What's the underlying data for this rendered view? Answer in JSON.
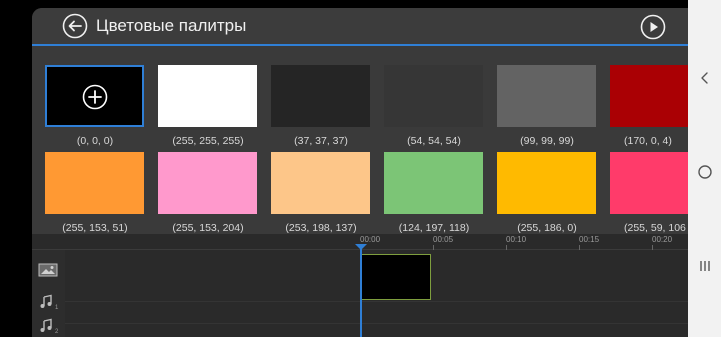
{
  "header": {
    "title": "Цветовые палитры",
    "back_icon": "back-arrow-circle-icon",
    "play_icon": "play-circle-icon"
  },
  "palettes": [
    {
      "label": "(0, 0, 0)",
      "color": "#000000",
      "selected": true,
      "add": true
    },
    {
      "label": "(255, 255, 255)",
      "color": "#ffffff"
    },
    {
      "label": "(37, 37, 37)",
      "color": "#252525"
    },
    {
      "label": "(54, 54, 54)",
      "color": "#363636"
    },
    {
      "label": "(99, 99, 99)",
      "color": "#636363"
    },
    {
      "label": "(170, 0, 4)",
      "color": "#aa0004"
    },
    {
      "label": "(255, 153, 51)",
      "color": "#ff9933"
    },
    {
      "label": "(255, 153, 204)",
      "color": "#ff99cc"
    },
    {
      "label": "(253, 198, 137)",
      "color": "#fdc689"
    },
    {
      "label": "(124, 197, 118)",
      "color": "#7cc576"
    },
    {
      "label": "(255, 186, 0)",
      "color": "#ffba00"
    },
    {
      "label": "(255, 59, 106",
      "color": "#ff3b6a"
    }
  ],
  "timeline": {
    "ticks": [
      "00:00",
      "00:05",
      "00:10",
      "00:15",
      "00:20"
    ],
    "tracks": [
      {
        "icon": "image-track-icon"
      },
      {
        "icon": "music-track-1-icon",
        "index": "1"
      },
      {
        "icon": "music-track-2-icon",
        "index": "2"
      }
    ]
  },
  "colors": {
    "accent": "#2f7fd6",
    "background": "#3a3a3a",
    "timeline_bg": "#2a2a2a",
    "clip_border": "#7e9e3e"
  },
  "system_nav": {
    "back_icon": "chevron-left-icon",
    "home_icon": "home-circle-icon",
    "recents_icon": "recents-lines-icon"
  }
}
